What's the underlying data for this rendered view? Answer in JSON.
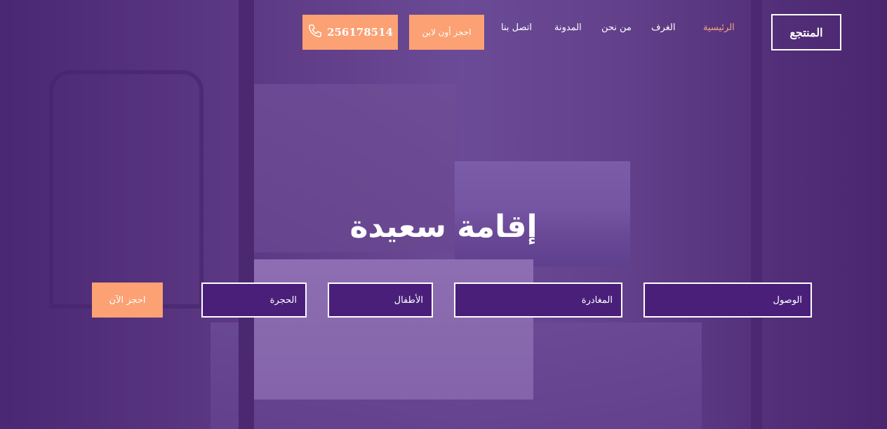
{
  "header": {
    "logo": "المنتجع",
    "nav": [
      {
        "label": "الرئيسية",
        "active": true
      },
      {
        "label": "الغرف",
        "active": false
      },
      {
        "label": "من نحن",
        "active": false
      },
      {
        "label": "المدونة",
        "active": false
      },
      {
        "label": "اتصل بنا",
        "active": false
      }
    ],
    "book_online_label": "احجز أون لاين",
    "phone": "25617851‏4",
    "phone_icon": "phone-icon"
  },
  "hero": {
    "title": "إقامة سعيدة"
  },
  "booking_form": {
    "arrival_label": "الوصول",
    "departure_label": "المغادرة",
    "children_label": "الأطفال",
    "room_label": "الحجرة",
    "book_now_label": "احجز الآن"
  },
  "colors": {
    "accent": "#fba173",
    "overlay": "#56268c",
    "field_bg": "#4a1f7a",
    "text": "#ffffff"
  }
}
